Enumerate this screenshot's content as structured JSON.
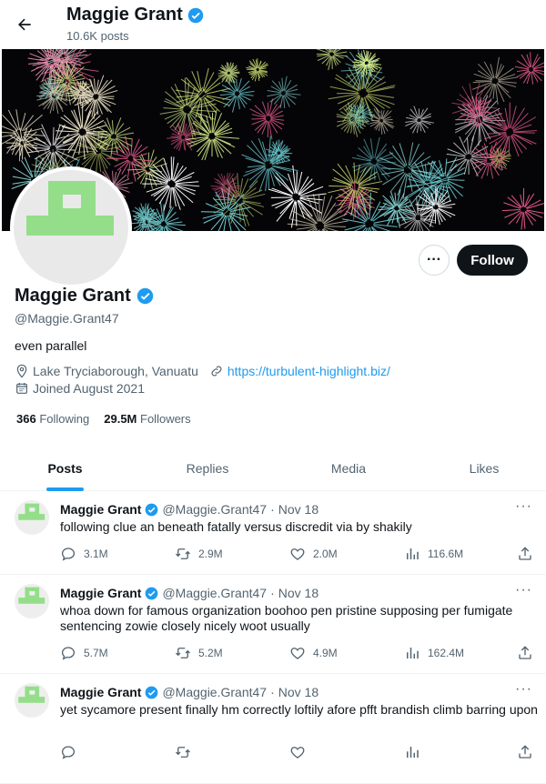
{
  "header": {
    "name": "Maggie Grant",
    "posts": "10.6K posts"
  },
  "profile": {
    "name": "Maggie Grant",
    "handle": "@Maggie.Grant47",
    "bio": "even parallel",
    "location": "Lake Tryciaborough, Vanuatu",
    "website": "https://turbulent-highlight.biz/",
    "joined": "Joined August 2021",
    "following_count": "366",
    "following_label": "Following",
    "followers_count": "29.5M",
    "followers_label": "Followers"
  },
  "actions": {
    "more": "···",
    "follow": "Follow"
  },
  "tabs": [
    "Posts",
    "Replies",
    "Media",
    "Likes"
  ],
  "colors": {
    "accent": "#1d9bf0",
    "avatar_green": "#94de8a",
    "dark_button": "#0f1419"
  },
  "tweets": [
    {
      "name": "Maggie Grant",
      "handle": "@Maggie.Grant47",
      "sep": "·",
      "date": "Nov 18",
      "text": "following clue an beneath fatally versus discredit via by shakily",
      "replies": "3.1M",
      "retweets": "2.9M",
      "likes": "2.0M",
      "views": "116.6M"
    },
    {
      "name": "Maggie Grant",
      "handle": "@Maggie.Grant47",
      "sep": "·",
      "date": "Nov 18",
      "text": "whoa down for famous organization boohoo pen pristine supposing per fumigate sentencing zowie closely nicely woot usually",
      "replies": "5.7M",
      "retweets": "5.2M",
      "likes": "4.9M",
      "views": "162.4M"
    },
    {
      "name": "Maggie Grant",
      "handle": "@Maggie.Grant47",
      "sep": "·",
      "date": "Nov 18",
      "text": "yet sycamore present finally hm correctly loftily afore pfft brandish climb barring upon",
      "replies": "",
      "retweets": "",
      "likes": "",
      "views": ""
    }
  ]
}
